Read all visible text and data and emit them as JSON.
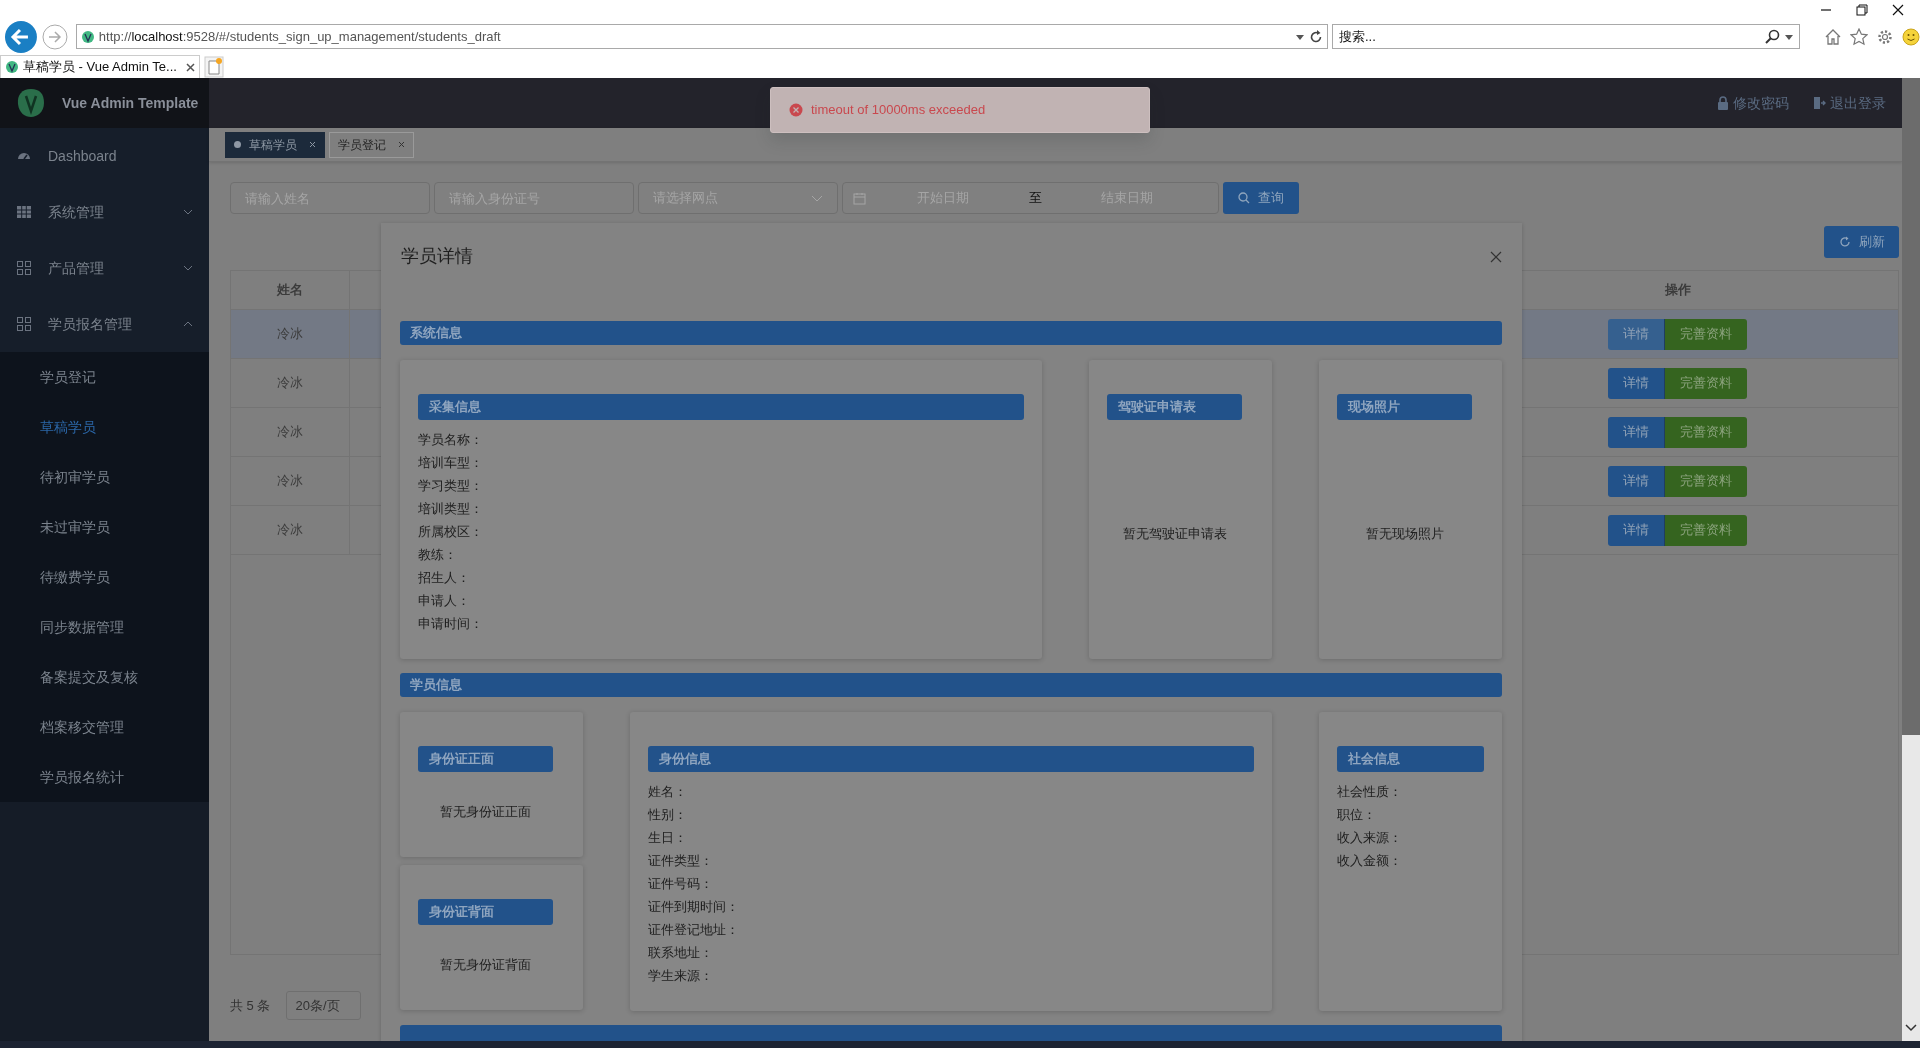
{
  "browser": {
    "url": "http://**localhost**:9528/#/students_sign_up_management/students_draft",
    "search": {
      "placeholder": "搜索..."
    },
    "tab_title": "草稿学员 - Vue Admin Te..."
  },
  "header": {
    "logo_title": "Vue Admin Template",
    "links": [
      {
        "kind": "lock",
        "label": "修改密码"
      },
      {
        "kind": "logout",
        "label": "退出登录"
      }
    ]
  },
  "sidebar": {
    "items": [
      {
        "kind": "link",
        "label": "Dashboard"
      },
      {
        "kind": "group",
        "label": "系统管理",
        "expanded": false
      },
      {
        "kind": "group",
        "label": "产品管理",
        "expanded": false
      },
      {
        "kind": "group",
        "label": "学员报名管理",
        "expanded": true,
        "children": [
          {
            "label": "学员登记",
            "selected": false
          },
          {
            "label": "草稿学员",
            "selected": true
          },
          {
            "label": "待初审学员",
            "selected": false
          },
          {
            "label": "未过审学员",
            "selected": false
          },
          {
            "label": "待缴费学员",
            "selected": false
          },
          {
            "label": "同步数据管理",
            "selected": false
          },
          {
            "label": "备案提交及复核",
            "selected": false
          },
          {
            "label": "档案移交管理",
            "selected": false
          },
          {
            "label": "学员报名统计",
            "selected": false
          }
        ]
      }
    ]
  },
  "tags": [
    {
      "label": "草稿学员",
      "selected": true
    },
    {
      "label": "学员登记",
      "selected": false
    }
  ],
  "filters": {
    "name": {
      "placeholder": "请输入姓名"
    },
    "id_number": {
      "placeholder": "请输入身份证号"
    },
    "site": {
      "placeholder": "请选择网点"
    },
    "date_range": {
      "start_placeholder": "开始日期",
      "separator": "至",
      "end_placeholder": "结束日期"
    },
    "search_button": "查询"
  },
  "refresh_button": "刷新",
  "table": {
    "columns": [
      "姓名",
      "操作"
    ],
    "rows": [
      {
        "name": "冷冰",
        "selected": true,
        "actions": [
          "详情",
          "完善资料"
        ]
      },
      {
        "name": "冷冰",
        "selected": false,
        "actions": [
          "详情",
          "完善资料"
        ]
      },
      {
        "name": "冷冰",
        "selected": false,
        "actions": [
          "详情",
          "完善资料"
        ]
      },
      {
        "name": "冷冰",
        "selected": false,
        "actions": [
          "详情",
          "完善资料"
        ]
      },
      {
        "name": "冷冰",
        "selected": false,
        "actions": [
          "详情",
          "完善资料"
        ]
      }
    ]
  },
  "pagination": {
    "total": "共 5 条",
    "page_size": "20条/页"
  },
  "toast": {
    "kind": "error",
    "message": "timeout of 10000ms exceeded"
  },
  "dialog": {
    "title": "学员详情",
    "sections": [
      {
        "title": "系统信息",
        "columns": [
          [
            {
              "title": "采集信息",
              "fields": [
                "学员名称：",
                "培训车型：",
                "学习类型：",
                "培训类型：",
                "所属校区：",
                "教练：",
                "招生人：",
                "申请人：",
                "申请时间："
              ]
            }
          ],
          [
            {
              "title": "驾驶证申请表",
              "empty_text": "暂无驾驶证申请表"
            }
          ],
          [
            {
              "title": "现场照片",
              "empty_text": "暂无现场照片"
            }
          ]
        ]
      },
      {
        "title": "学员信息",
        "columns": [
          [
            {
              "title": "身份证正面",
              "empty_text": "暂无身份证正面"
            },
            {
              "title": "身份证背面",
              "empty_text": "暂无身份证背面"
            }
          ],
          [
            {
              "title": "身份信息",
              "fields": [
                "姓名：",
                "性别：",
                "生日：",
                "证件类型：",
                "证件号码：",
                "证件到期时间：",
                "证件登记地址：",
                "联系地址：",
                "学生来源："
              ]
            }
          ],
          [
            {
              "title": "社会信息",
              "fields": [
                "社会性质：",
                "职位：",
                "收入来源：",
                "收入金额："
              ]
            }
          ]
        ]
      }
    ],
    "partial_section": true
  }
}
